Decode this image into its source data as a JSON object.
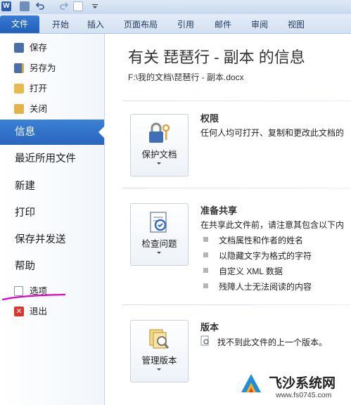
{
  "ribbon": {
    "tabs": [
      {
        "label": "文件"
      },
      {
        "label": "开始"
      },
      {
        "label": "插入"
      },
      {
        "label": "页面布局"
      },
      {
        "label": "引用"
      },
      {
        "label": "邮件"
      },
      {
        "label": "审阅"
      },
      {
        "label": "视图"
      }
    ]
  },
  "backstage": {
    "commands": {
      "save": "保存",
      "save_as": "另存为",
      "open": "打开",
      "close": "关闭"
    },
    "tabs": {
      "info": "信息",
      "recent": "最近所用文件",
      "new": "新建",
      "print": "打印",
      "save_send": "保存并发送",
      "help": "帮助"
    },
    "options": "选项",
    "exit": "退出",
    "selected": "信息"
  },
  "main": {
    "title": "有关 琵琶行 - 副本 的信息",
    "path": "F:\\我的文档\\琵琶行 - 副本.docx",
    "permissions": {
      "button": "保护文档",
      "heading": "权限",
      "text": "任何人均可打开、复制和更改此文档的"
    },
    "prepare": {
      "button": "检查问题",
      "heading": "准备共享",
      "text": "在共享此文件前，请注意其包含以下内",
      "items": [
        "文档属性和作者的姓名",
        "以隐藏文字为格式的字符",
        "自定义 XML 数据",
        "残障人士无法阅读的内容"
      ]
    },
    "versions": {
      "button": "管理版本",
      "heading": "版本",
      "text": "找不到此文件的上一个版本。"
    }
  },
  "watermark": {
    "name": "飞沙系统网",
    "url": "www.fs0745.com"
  },
  "colors": {
    "accent": "#2a66bd",
    "annotation": "#e000c8"
  }
}
